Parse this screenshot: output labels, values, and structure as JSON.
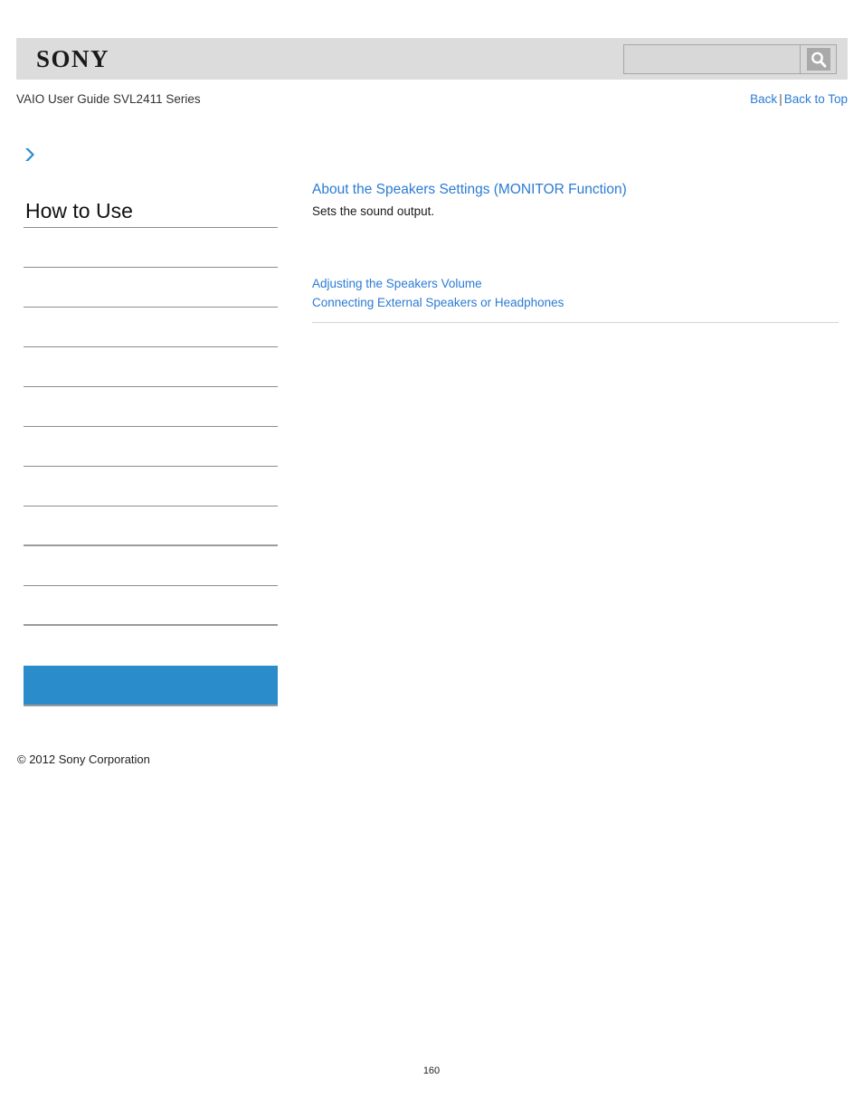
{
  "header": {
    "logo_text": "SONY",
    "search": {
      "value": "",
      "placeholder": "",
      "icon": "search-icon"
    }
  },
  "breadcrumb": {
    "guide_title": "VAIO User Guide SVL2411 Series"
  },
  "nav": {
    "back_label": "Back",
    "separator": "|",
    "back_to_top_label": "Back to Top"
  },
  "sidebar": {
    "expand_icon": "chevron-right-icon",
    "heading": "How to Use",
    "items": [
      {
        "label": "",
        "style": "normal"
      },
      {
        "label": "",
        "style": "normal"
      },
      {
        "label": "",
        "style": "normal"
      },
      {
        "label": "",
        "style": "normal"
      },
      {
        "label": "",
        "style": "normal"
      },
      {
        "label": "",
        "style": "normal"
      },
      {
        "label": "",
        "style": "normal"
      },
      {
        "label": "",
        "style": "thick"
      },
      {
        "label": "",
        "style": "normal"
      },
      {
        "label": "",
        "style": "thick"
      },
      {
        "label": "",
        "style": "spacer"
      },
      {
        "label": "",
        "style": "selected"
      }
    ]
  },
  "footer": {
    "copyright": "© 2012 Sony Corporation",
    "page_number": "160"
  },
  "main": {
    "title": "About the Speakers Settings (MONITOR Function)",
    "description": "Sets the sound output.",
    "related_links": [
      "Adjusting the Speakers Volume",
      "Connecting External Speakers or Headphones"
    ]
  },
  "colors": {
    "link": "#2b7bd4",
    "selected_bg": "#2b8ccb",
    "header_bg": "#dcdcdc"
  }
}
